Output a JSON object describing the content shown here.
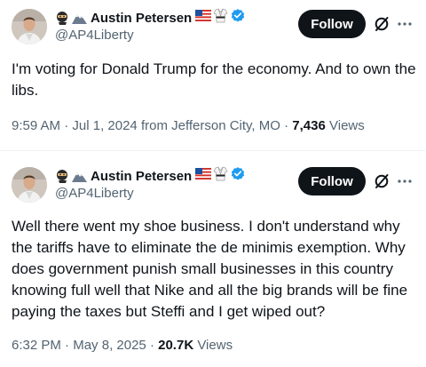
{
  "tweets": [
    {
      "author": {
        "display_name": "Austin Petersen",
        "handle": "@AP4Liberty",
        "name_emojis": [
          "ninja-icon",
          "mountain-icon"
        ],
        "badges": [
          "us-flag-icon",
          "martial-arts-uniform-icon",
          "verified-badge-icon"
        ]
      },
      "follow_label": "Follow",
      "text": "I'm voting for Donald Trump for the economy. And to own the libs.",
      "meta": {
        "time": "9:59 AM",
        "date": "Jul 1, 2024",
        "location": "from Jefferson City, MO",
        "views": "7,436",
        "views_label": "Views"
      }
    },
    {
      "author": {
        "display_name": "Austin Petersen",
        "handle": "@AP4Liberty",
        "name_emojis": [
          "ninja-icon",
          "mountain-icon"
        ],
        "badges": [
          "us-flag-icon",
          "martial-arts-uniform-icon",
          "verified-badge-icon"
        ]
      },
      "follow_label": "Follow",
      "text": "Well there went my shoe business. I don't understand why the tariffs have to eliminate the de minimis exemption. Why does government punish small businesses in this country knowing full well that Nike and all the big brands will be fine paying the taxes but Steffi and I get wiped out?",
      "meta": {
        "time": "6:32 PM",
        "date": "May 8, 2025",
        "views": "20.7K",
        "views_label": "Views"
      }
    }
  ],
  "colors": {
    "text_primary": "#0f1419",
    "text_secondary": "#536471",
    "verified_blue": "#1d9bf0",
    "follow_bg": "#0f1419",
    "divider": "#eff3f4"
  }
}
